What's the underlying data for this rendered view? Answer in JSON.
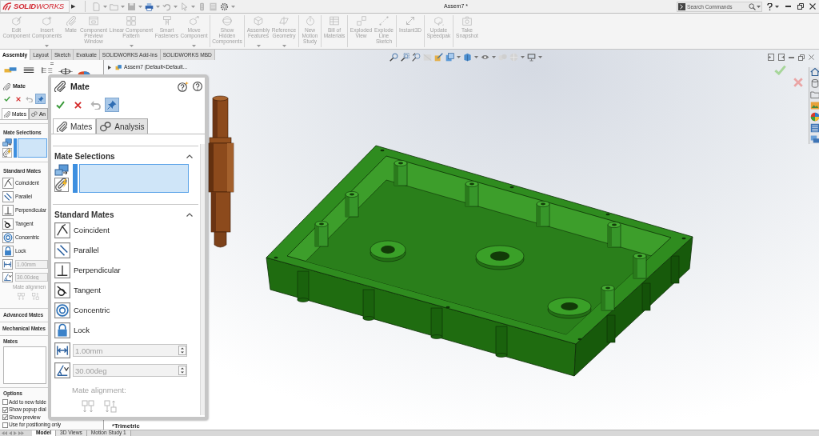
{
  "title_bar": {
    "logo": "**SOLID**WORKS",
    "expand_arrow": "▶",
    "document_title": "Assem7 *",
    "search": {
      "placeholder": "Search Commands"
    }
  },
  "ribbon": [
    {
      "label": "Edit Component",
      "disabled": true,
      "dropdown": false
    },
    {
      "label": "Insert Components",
      "disabled": true,
      "dropdown": true
    },
    {
      "label": "Mate",
      "disabled": true,
      "dropdown": false
    },
    {
      "label": "Component Preview Window",
      "disabled": true,
      "dropdown": false
    },
    {
      "label": "Linear Component Pattern",
      "disabled": true,
      "dropdown": true
    },
    {
      "label": "Smart Fasteners",
      "disabled": true,
      "dropdown": false
    },
    {
      "label": "Move Component",
      "disabled": true,
      "dropdown": true
    },
    {
      "label": "Show Hidden Components",
      "disabled": true,
      "dropdown": false
    },
    {
      "label": "Assembly Features",
      "disabled": true,
      "dropdown": true
    },
    {
      "label": "Reference Geometry",
      "disabled": true,
      "dropdown": true
    },
    {
      "label": "New Motion Study",
      "disabled": true,
      "dropdown": false
    },
    {
      "label": "Bill of Materials",
      "disabled": true,
      "dropdown": false
    },
    {
      "label": "Exploded View",
      "disabled": true,
      "dropdown": false
    },
    {
      "label": "Explode Line Sketch",
      "disabled": true,
      "dropdown": false
    },
    {
      "label": "Instant3D",
      "disabled": true,
      "dropdown": false
    },
    {
      "label": "Update Speedpak",
      "disabled": true,
      "dropdown": false
    },
    {
      "label": "Take Snapshot",
      "disabled": true,
      "dropdown": false
    }
  ],
  "command_tabs": [
    {
      "label": "Assembly",
      "selected": true
    },
    {
      "label": "Layout",
      "selected": false
    },
    {
      "label": "Sketch",
      "selected": false
    },
    {
      "label": "Evaluate",
      "selected": false
    },
    {
      "label": "SOLIDWORKS Add-Ins",
      "selected": false
    },
    {
      "label": "SOLIDWORKS MBD",
      "selected": false
    }
  ],
  "left_panel": {
    "title": "Mate",
    "keep_visible": true,
    "tabs": [
      {
        "label": "Mates",
        "selected": true
      },
      {
        "label": "An",
        "selected": false
      }
    ],
    "mate_selections": "Mate Selections",
    "standard_mates": "Standard Mates",
    "mate_types": [
      "Coincident",
      "Parallel",
      "Perpendicular",
      "Tangent",
      "Concentric",
      "Lock"
    ],
    "fields": [
      {
        "value": "1.00mm",
        "disabled": true
      },
      {
        "value": "30.00deg",
        "disabled": true
      }
    ],
    "alignment_label": "Mate alignmen",
    "advanced_mates": "Advanced Mates",
    "mechanical_mates": "Mechanical Mates",
    "mates_heading": "Mates",
    "options_heading": "Options",
    "options": [
      {
        "label": "Add to new folde",
        "checked": false
      },
      {
        "label": "Show popup dial",
        "checked": true
      },
      {
        "label": "Show preview",
        "checked": true
      },
      {
        "label": "Use for positioning only",
        "checked": false
      }
    ]
  },
  "mate_panel": {
    "title": "Mate",
    "keep_visible": true,
    "tabs": [
      {
        "label": "Mates",
        "selected": true
      },
      {
        "label": "Analysis",
        "selected": false
      }
    ],
    "sections": [
      {
        "heading": "Mate Selections",
        "expanded": true
      },
      {
        "heading": "Standard Mates",
        "expanded": true
      }
    ],
    "mate_types": [
      "Coincident",
      "Parallel",
      "Perpendicular",
      "Tangent",
      "Concentric",
      "Lock"
    ],
    "fields": [
      {
        "value": "1.00mm",
        "disabled": true
      },
      {
        "value": "30.00deg",
        "disabled": true
      }
    ],
    "alignment_label": "Mate alignment:"
  },
  "viewport": {
    "tree_root": "Assem7 (Default<Default...",
    "view_name": "*Trimetric"
  },
  "bottom_tabs": [
    {
      "label": "Model",
      "selected": true
    },
    {
      "label": "3D Views",
      "selected": false
    },
    {
      "label": "Motion Study 1",
      "selected": false
    }
  ]
}
